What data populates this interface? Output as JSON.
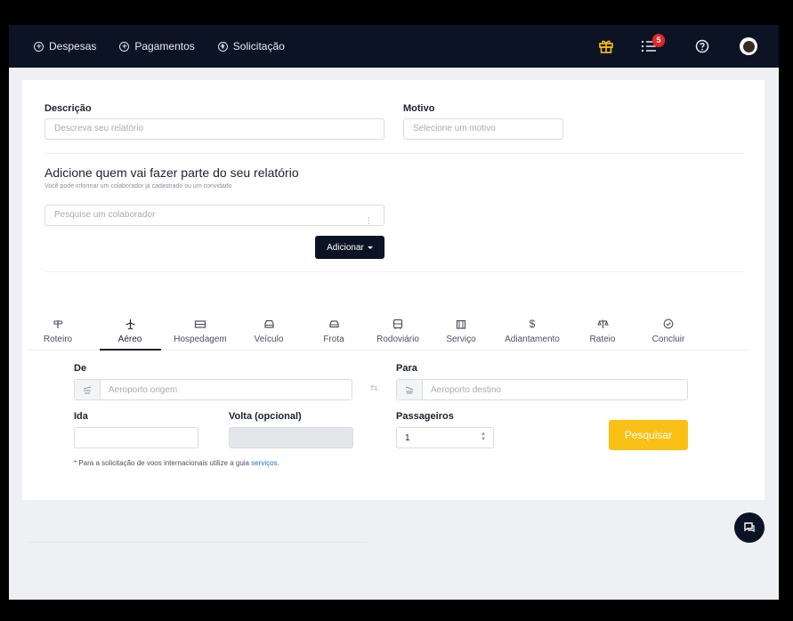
{
  "nav": {
    "items": [
      {
        "label": "Despesas"
      },
      {
        "label": "Pagamentos"
      },
      {
        "label": "Solicitação"
      }
    ],
    "notifications_count": "5"
  },
  "report": {
    "descricao_label": "Descrição",
    "descricao_placeholder": "Descreva seu relatório",
    "motivo_label": "Motivo",
    "motivo_placeholder": "Selecione um motivo",
    "participants_title": "Adicione quem vai fazer parte do seu relatório",
    "participants_subtitle": "Você pode informar um colaborador já cadastrado ou um convidado",
    "search_placeholder": "Pesquise um colaborador",
    "add_button": "Adicionar"
  },
  "tabs": [
    {
      "label": "Roteiro",
      "icon": "signpost-icon"
    },
    {
      "label": "Aéreo",
      "icon": "airplane-icon",
      "active": true
    },
    {
      "label": "Hospedagem",
      "icon": "bed-icon"
    },
    {
      "label": "Veículo",
      "icon": "car-icon"
    },
    {
      "label": "Frota",
      "icon": "car-icon"
    },
    {
      "label": "Rodoviário",
      "icon": "bus-icon"
    },
    {
      "label": "Serviço",
      "icon": "briefcase-icon"
    },
    {
      "label": "Adiantamento",
      "icon": "dollar-icon"
    },
    {
      "label": "Rateio",
      "icon": "scale-icon"
    },
    {
      "label": "Concluir",
      "icon": "check-circle-icon"
    }
  ],
  "flight": {
    "de_label": "De",
    "origem_placeholder": "Aeroporto origem",
    "para_label": "Para",
    "destino_placeholder": "Aeroporto destino",
    "ida_label": "Ida",
    "volta_label": "Volta (opcional)",
    "passageiros_label": "Passageiros",
    "passageiros_value": "1",
    "search_button": "Pesquisar",
    "note_text": "* Para a solicitação de voos internacionais utilize a guia",
    "note_link": "serviços."
  },
  "colors": {
    "topbar": "#0c1324",
    "accent_yellow": "#fbc015",
    "badge_red": "#e5252a",
    "link_blue": "#1a73c8"
  }
}
